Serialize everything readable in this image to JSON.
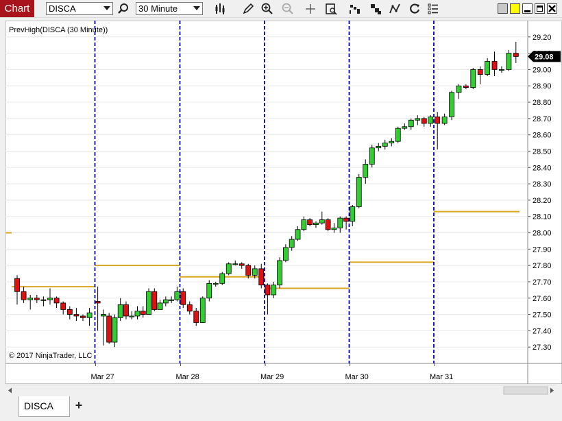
{
  "toolbar": {
    "chart_label": "Chart",
    "instrument": "DISCA",
    "interval": "30 Minute"
  },
  "chart": {
    "indicator_label": "PrevHigh(DISCA (30 Minute))",
    "copyright": "© 2017 NinjaTrader, LLC",
    "current_price_label": "29.08",
    "colors": {
      "up": "#33cc33",
      "down": "#dd1111",
      "prev_high": "#daa520",
      "separator": "#0000aa",
      "price_marker": "#000000"
    }
  },
  "chart_data": {
    "type": "candlestick",
    "ylim": [
      27.2,
      29.3
    ],
    "y_ticks": [
      "29.20",
      "29.10",
      "29.00",
      "28.90",
      "28.80",
      "28.70",
      "28.60",
      "28.50",
      "28.40",
      "28.30",
      "28.20",
      "28.10",
      "28.00",
      "27.90",
      "27.80",
      "27.70",
      "27.60",
      "27.50",
      "27.40",
      "27.30"
    ],
    "x_labels": [
      "Mar 27",
      "Mar 28",
      "Mar 29",
      "Mar 30",
      "Mar 31"
    ],
    "current_price": 29.08,
    "days": [
      {
        "label": "Mar 27",
        "prev_high": 27.8,
        "candles": [
          [
            27.58,
            27.57,
            27.67,
            27.4
          ],
          [
            27.49,
            27.5,
            27.53,
            27.31
          ],
          [
            27.49,
            27.33,
            27.51,
            27.32
          ],
          [
            27.33,
            27.48,
            27.5,
            27.3
          ],
          [
            27.48,
            27.56,
            27.6,
            27.46
          ],
          [
            27.56,
            27.49,
            27.58,
            27.47
          ],
          [
            27.49,
            27.49,
            27.52,
            27.47
          ],
          [
            27.49,
            27.52,
            27.55,
            27.47
          ],
          [
            27.52,
            27.5,
            27.55,
            27.48
          ],
          [
            27.5,
            27.64,
            27.66,
            27.5
          ],
          [
            27.64,
            27.53,
            27.66,
            27.52
          ],
          [
            27.53,
            27.57,
            27.59,
            27.53
          ],
          [
            27.57,
            27.59,
            27.61,
            27.55
          ],
          [
            27.59,
            27.59,
            27.61,
            27.57
          ],
          [
            27.59,
            27.64,
            27.67,
            27.58
          ]
        ]
      },
      {
        "label": "Mar 28",
        "prev_high": 27.73,
        "candles": [
          [
            27.64,
            27.56,
            27.66,
            27.54
          ],
          [
            27.56,
            27.52,
            27.58,
            27.5
          ],
          [
            27.52,
            27.45,
            27.54,
            27.43
          ],
          [
            27.45,
            27.6,
            27.61,
            27.45
          ],
          [
            27.6,
            27.69,
            27.71,
            27.58
          ],
          [
            27.69,
            27.69,
            27.7,
            27.67
          ],
          [
            27.69,
            27.75,
            27.76,
            27.68
          ],
          [
            27.75,
            27.81,
            27.82,
            27.74
          ],
          [
            27.81,
            27.81,
            27.83,
            27.8
          ],
          [
            27.81,
            27.8,
            27.82,
            27.78
          ],
          [
            27.8,
            27.74,
            27.81,
            27.72
          ],
          [
            27.74,
            27.78,
            27.8,
            27.72
          ],
          [
            27.78,
            27.68,
            27.81,
            27.66
          ]
        ]
      },
      {
        "label": "Mar 29",
        "prev_high": 27.66,
        "candles": [
          [
            27.68,
            27.62,
            27.69,
            27.5
          ],
          [
            27.62,
            27.68,
            27.7,
            27.6
          ],
          [
            27.68,
            27.83,
            27.85,
            27.66
          ],
          [
            27.83,
            27.91,
            27.93,
            27.82
          ],
          [
            27.91,
            27.96,
            27.98,
            27.89
          ],
          [
            27.96,
            28.02,
            28.04,
            27.95
          ],
          [
            28.02,
            28.08,
            28.1,
            28.01
          ],
          [
            28.08,
            28.05,
            28.09,
            28.04
          ],
          [
            28.05,
            28.06,
            28.07,
            28.03
          ],
          [
            28.06,
            28.08,
            28.13,
            28.05
          ],
          [
            28.08,
            28.02,
            28.09,
            28.01
          ],
          [
            28.02,
            28.03,
            28.06,
            28.0
          ],
          [
            28.03,
            28.09,
            28.1,
            28.0
          ],
          [
            28.09,
            28.07,
            28.1,
            28.02
          ]
        ]
      },
      {
        "label": "Mar 30",
        "prev_high": 27.82,
        "candles": [
          [
            28.07,
            28.16,
            28.17,
            28.04
          ],
          [
            28.16,
            28.34,
            28.36,
            28.15
          ],
          [
            28.34,
            28.42,
            28.45,
            28.3
          ],
          [
            28.42,
            28.52,
            28.54,
            28.4
          ],
          [
            28.52,
            28.53,
            28.55,
            28.5
          ],
          [
            28.53,
            28.55,
            28.57,
            28.51
          ],
          [
            28.55,
            28.56,
            28.58,
            28.53
          ],
          [
            28.56,
            28.64,
            28.65,
            28.55
          ],
          [
            28.64,
            28.65,
            28.67,
            28.63
          ],
          [
            28.65,
            28.69,
            28.7,
            28.63
          ],
          [
            28.69,
            28.7,
            28.72,
            28.66
          ],
          [
            28.7,
            28.67,
            28.71,
            28.65
          ],
          [
            28.67,
            28.71,
            28.72,
            28.65
          ]
        ]
      },
      {
        "label": "Mar 31",
        "prev_high": 28.13,
        "candles": [
          [
            28.71,
            28.67,
            28.74,
            28.51
          ],
          [
            28.67,
            28.71,
            28.73,
            28.66
          ],
          [
            28.71,
            28.86,
            28.87,
            28.69
          ],
          [
            28.86,
            28.9,
            28.91,
            28.82
          ],
          [
            28.9,
            28.89,
            28.91,
            28.88
          ],
          [
            28.89,
            29.0,
            29.01,
            28.88
          ],
          [
            29.0,
            28.97,
            29.02,
            28.91
          ],
          [
            28.97,
            29.05,
            29.07,
            28.96
          ],
          [
            29.05,
            29.0,
            29.11,
            28.96
          ],
          [
            29.0,
            29.0,
            29.02,
            28.98
          ],
          [
            29.0,
            29.1,
            29.12,
            28.99
          ],
          [
            29.1,
            29.08,
            29.17,
            29.04
          ]
        ]
      }
    ],
    "prior_prev_high": 27.67
  },
  "tabs": {
    "active": "DISCA",
    "add": "+"
  }
}
